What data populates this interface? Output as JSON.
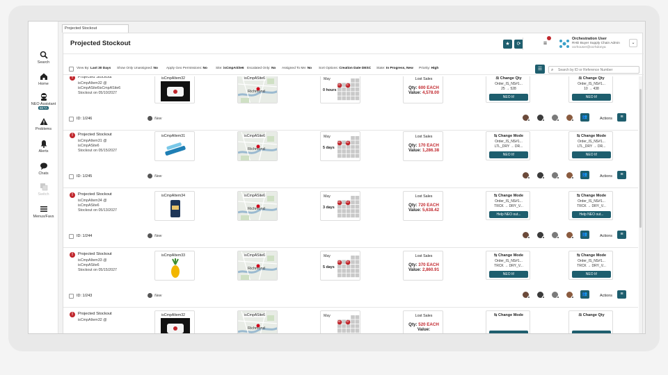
{
  "nav": [
    {
      "label": "Search",
      "icon": "search-icon"
    },
    {
      "label": "Home",
      "icon": "home-icon"
    },
    {
      "label": "NEO Assistant",
      "badge": "BETA",
      "icon": "neo-assistant-icon"
    },
    {
      "label": "Problems",
      "icon": "warning-icon"
    },
    {
      "label": "Alerts",
      "icon": "bell-icon"
    },
    {
      "label": "Chats",
      "icon": "chat-icon"
    },
    {
      "label": "Switch",
      "icon": "switch-icon"
    },
    {
      "label": "Menus/Favs",
      "icon": "menu-icon"
    }
  ],
  "tab": {
    "label": "Projected Stockout"
  },
  "header": {
    "title": "Projected Stockout",
    "user_name": "Orchestration User",
    "user_role": "RHD Buyer Supply Chain Admin",
    "user_email": "ocrhouser@ocrhdonya"
  },
  "filters": [
    {
      "label": "View By:",
      "value": "Last 30 Days"
    },
    {
      "label": "Show Only Unassigned:",
      "value": "No"
    },
    {
      "label": "Apply Geo Permissions:",
      "value": "No"
    },
    {
      "label": "Site:",
      "value": "isCmpASite6"
    },
    {
      "label": "Escalated Only:",
      "value": "No"
    },
    {
      "label": "Assigned To Me:",
      "value": "No"
    },
    {
      "label": "Sort Options:",
      "value": "Creation Date DESC"
    },
    {
      "label": "State:",
      "value": "In Progress, New"
    },
    {
      "label": "Priority:",
      "value": "High"
    }
  ],
  "search": {
    "placeholder": "Search by ID or Reference Number"
  },
  "cards": [
    {
      "title": "Projected Stockout",
      "line1": "isCmpAItem32 @",
      "line2": "isCmpASite6isCmpASite6",
      "line3": "Stockout on 05/10/2027",
      "item": "isCmpAItem32",
      "site": "isCmpASite6",
      "map_city": "Richmond",
      "month": "May",
      "days": "0 hours",
      "cal_marks": [
        "10",
        "11"
      ],
      "lost_sales": "Lost Sales",
      "qty_label": "Qty:",
      "qty": "600 EACH",
      "value_label": "Value:",
      "value": "4,578.00",
      "action1": {
        "title": "Change Qty",
        "l1": "Order_IS_NS#1...",
        "l2": "25 → 528",
        "btn": "NEO It!"
      },
      "action2": {
        "title": "Change Qty",
        "l1": "Order_IS_NS#1...",
        "l2": "10 → 438",
        "btn": "NEO It!"
      },
      "id": "ID: 1/246",
      "status": "New"
    },
    {
      "title": "Projected Stockout",
      "line1": "isCmpAItem31 @",
      "line2": "isCmpASite6",
      "line3": "Stockout on 05/15/2027",
      "item": "isCmpAItem31",
      "site": "isCmpASite6",
      "map_city": "Richmond",
      "month": "May",
      "days": "5 days",
      "cal_marks": [
        "10",
        "15"
      ],
      "lost_sales": "Lost Sales",
      "qty_label": "Qty:",
      "qty": "170 EACH",
      "value_label": "Value:",
      "value": "1,286.38",
      "action1": {
        "title": "Change Mode",
        "l1": "Order_IS_NS#1...",
        "l2": "LTL_DRY → DR...",
        "btn": "NEO It!"
      },
      "action2": {
        "title": "Change Mode",
        "l1": "Order_IS_NS#1...",
        "l2": "LTL_DRY → DR...",
        "btn": "NEO It!"
      },
      "id": "ID: 1/245",
      "status": "New"
    },
    {
      "title": "Projected Stockout",
      "line1": "isCmpAItem34 @",
      "line2": "isCmpASite6",
      "line3": "Stockout on 05/13/2027",
      "item": "isCmpAItem34",
      "site": "isCmpASite6",
      "map_city": "Richmond",
      "month": "May",
      "days": "3 days",
      "cal_marks": [
        "10",
        "13"
      ],
      "lost_sales": "Lost Sales",
      "qty_label": "Qty:",
      "qty": "720 EACH",
      "value_label": "Value:",
      "value": "5,638.42",
      "action1": {
        "title": "Change Mode",
        "l1": "Order_IS_NS#1...",
        "l2": "TRCK → DRY_V...",
        "btn": "Help NEO out..."
      },
      "action2": {
        "title": "Change Mode",
        "l1": "Order_IS_NS#1...",
        "l2": "TRCK → DRY_V...",
        "btn": "Help NEO out..."
      },
      "id": "ID: 1/244",
      "status": "New"
    },
    {
      "title": "Projected Stockout",
      "line1": "isCmpAItem33 @",
      "line2": "isCmpASite6",
      "line3": "Stockout on 05/15/2027",
      "item": "isCmpAItem33",
      "site": "isCmpASite6",
      "map_city": "Richmond",
      "month": "May",
      "days": "5 days",
      "cal_marks": [
        "10",
        "15"
      ],
      "lost_sales": "Lost Sales",
      "qty_label": "Qty:",
      "qty": "370 EACH",
      "value_label": "Value:",
      "value": "2,860.91",
      "action1": {
        "title": "Change Mode",
        "l1": "Order_IS_NS#1...",
        "l2": "TRCK → DRY_V...",
        "btn": "NEO It!"
      },
      "action2": {
        "title": "Change Mode",
        "l1": "Order_IS_NS#1...",
        "l2": "TRCK → DRY_V...",
        "btn": "NEO It!"
      },
      "id": "ID: 1/243",
      "status": "New"
    },
    {
      "title": "Projected Stockout",
      "line1": "isCmpAItem32 @",
      "line2": "",
      "line3": "",
      "item": "isCmpAItem32",
      "site": "isCmpASite6",
      "map_city": "Richmond",
      "month": "May",
      "days": "",
      "cal_marks": [
        "10",
        "12"
      ],
      "lost_sales": "Lost Sales",
      "qty_label": "Qty:",
      "qty": "520 EACH",
      "value_label": "Value:",
      "value": "",
      "action1": {
        "title": "Change Mode",
        "l1": "",
        "l2": "",
        "btn": ""
      },
      "action2": {
        "title": "Change Qty",
        "l1": "",
        "l2": "",
        "btn": ""
      },
      "id": "",
      "status": ""
    }
  ],
  "actions_label": "Actions",
  "colors": {
    "accent": "#1e5e6e",
    "alert": "#c0262c"
  }
}
